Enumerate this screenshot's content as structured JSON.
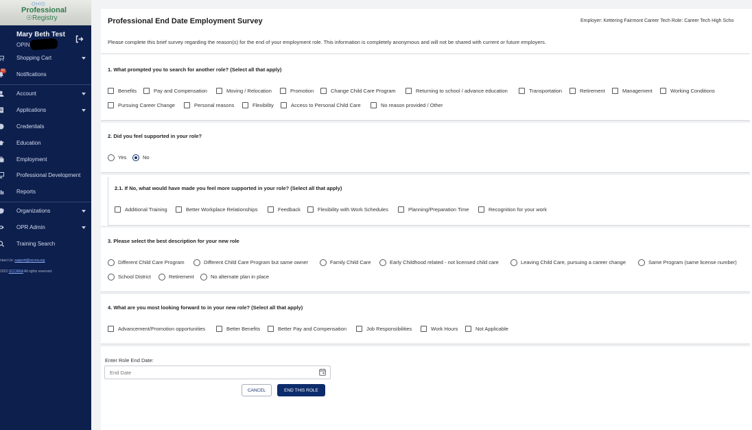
{
  "sidebar": {
    "logo": {
      "ohio": "OHIO",
      "professional": "Professional",
      "registry": "Registry"
    },
    "user": {
      "name": "Mary Beth Test",
      "opin_label": "OPIN:"
    },
    "notification_badge": "51",
    "items": [
      {
        "label": "Shopping Cart",
        "icon": "cart-icon",
        "has_caret": true
      },
      {
        "label": "Notifications",
        "icon": "bell-icon",
        "has_caret": false
      },
      {
        "label": "Account",
        "icon": "person-icon",
        "has_caret": true
      },
      {
        "label": "Applications",
        "icon": "document-icon",
        "has_caret": true
      },
      {
        "label": "Credentials",
        "icon": "badge-icon",
        "has_caret": false
      },
      {
        "label": "Education",
        "icon": "graduation-cap-icon",
        "has_caret": false
      },
      {
        "label": "Employment",
        "icon": "briefcase-icon",
        "has_caret": false
      },
      {
        "label": "Professional Development",
        "icon": "presentation-icon",
        "has_caret": false
      },
      {
        "label": "Reports",
        "icon": "chart-icon",
        "has_caret": false
      },
      {
        "label": "Organizations",
        "icon": "shield-icon",
        "has_caret": true
      },
      {
        "label": "OPR Admin",
        "icon": "eye-icon",
        "has_caret": true
      },
      {
        "label": "Training Search",
        "icon": "search-icon",
        "has_caret": false
      }
    ],
    "contact_prefix": "ntact Us:",
    "contact_email": "support@occrra.org",
    "copyright_prefix": "2023",
    "copyright_link": "OCCRRA",
    "copyright_suffix": "All rights reserved."
  },
  "survey": {
    "title": "Professional End Date Employment Survey",
    "employer_role": "Employer: Kettering Fairmont Career Tech    Role: Career Tech High Scho",
    "intro": "Please complete this brief survey regarding the reason(s) for the end of your employment role. This information is completely anonymous and will not be shared with current or future employers.",
    "q1": {
      "label": "1. What prompted you to search for another role? (Select all that apply)",
      "options": [
        "Benefits",
        "Pay and Compensation",
        "Moving / Relocation",
        "Promotion",
        "Change Child Care Program",
        "Returning to school / advance education",
        "Transportation",
        "Retirement",
        "Management",
        "Working Conditions",
        "Pursuing Career Change",
        "Personal reasons",
        "Flexibility",
        "Access to Personal Child Care",
        "No reason provided / Other"
      ]
    },
    "q2": {
      "label": "2. Did you feel supported in your role?",
      "options": [
        "Yes",
        "No"
      ],
      "selected": "No"
    },
    "q2_1": {
      "label": "2.1. If No, what would have made you feel more supported in your role? (Select all that apply)",
      "options": [
        "Additional Training",
        "Better Workplace Relationships",
        "Feedback",
        "Flexibility with Work Schedules",
        "Planning/Preparation Time",
        "Recognition for your work"
      ]
    },
    "q3": {
      "label": "3. Please select the best description for your new role",
      "options": [
        "Different Child Care Program",
        "Different Child Care Program but same owner",
        "Family Child Care",
        "Early Childhood related - not licensed child care",
        "Leaving Child Care, pursuing a career change",
        "Same Program (same license number)",
        "School District",
        "Retirement",
        "No alternate plan in place"
      ]
    },
    "q4": {
      "label": "4. What are you most looking forward to in your new role? (Select all that apply)",
      "options": [
        "Advancement/Promotion opportunities",
        "Better Benefits",
        "Better Pay and Compensation",
        "Job Responsibilities",
        "Work Hours",
        "Not Applicable"
      ]
    },
    "end_date": {
      "label": "Enter Role End Date:",
      "placeholder": "End Date",
      "value": ""
    },
    "buttons": {
      "cancel": "CANCEL",
      "submit": "END THIS ROLE"
    }
  },
  "colors": {
    "sidebar_bg": "#0d1f4d",
    "primary": "#0d2c6b",
    "logo_green": "#2f7a4b"
  }
}
